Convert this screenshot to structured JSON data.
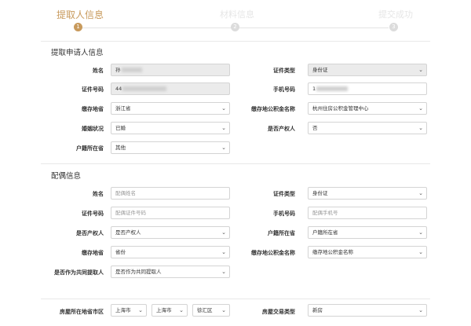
{
  "steps": [
    {
      "label": "提取人信息",
      "number": "1",
      "state": "active"
    },
    {
      "label": "材料信息",
      "number": "2",
      "state": "inactive"
    },
    {
      "label": "提交成功",
      "number": "3",
      "state": "inactive"
    }
  ],
  "applicant": {
    "title": "提取申请人信息",
    "name": {
      "label": "姓名",
      "value": "孙"
    },
    "id_type": {
      "label": "证件类型",
      "value": "身份证"
    },
    "id_number": {
      "label": "证件号码",
      "value": "44"
    },
    "phone": {
      "label": "手机号码",
      "value": "1"
    },
    "deposit_province": {
      "label": "缴存地省",
      "value": "浙江省"
    },
    "fund_center": {
      "label": "缴存地公积金名称",
      "value": "杭州住房公积金管理中心"
    },
    "marital": {
      "label": "婚姻状况",
      "value": "已婚"
    },
    "property_owner": {
      "label": "是否产权人",
      "value": "否"
    },
    "household": {
      "label": "户籍所在省",
      "value": "其他"
    }
  },
  "spouse": {
    "title": "配偶信息",
    "name": {
      "label": "姓名",
      "placeholder": "配偶姓名"
    },
    "id_type": {
      "label": "证件类型",
      "value": "身份证"
    },
    "id_number": {
      "label": "证件号码",
      "placeholder": "配偶证件号码"
    },
    "phone": {
      "label": "手机号码",
      "placeholder": "配偶手机号"
    },
    "property_owner": {
      "label": "是否产权人",
      "value": "是否产权人"
    },
    "household": {
      "label": "户籍所在省",
      "value": "户籍所在省"
    },
    "deposit_province": {
      "label": "缴存地省",
      "value": "省份"
    },
    "fund_center": {
      "label": "缴存地公积金名称",
      "value": "缴存地公积金名称"
    },
    "co_extractor": {
      "label": "是否作为共同提取人",
      "value": "是否作为共同提取人"
    }
  },
  "property": {
    "region": {
      "label": "房屋所在地省市区",
      "province": "上海市",
      "city": "上海市",
      "district": "徐汇区"
    },
    "trade_type": {
      "label": "房屋交易类型",
      "value": "新房"
    }
  },
  "colors": {
    "accent": "#c89a5c",
    "border": "#d4d4d4",
    "disabled": "#ebebeb"
  }
}
